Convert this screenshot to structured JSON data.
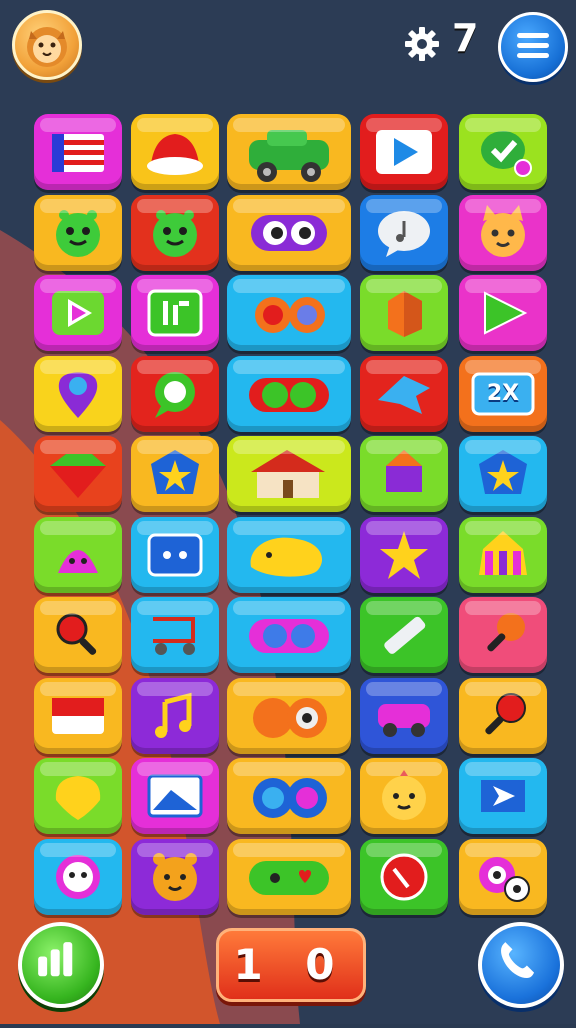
{
  "header": {
    "avatar_icon": "lion-avatar-icon",
    "settings_icon": "gear-icon",
    "level_value": "7",
    "menu_icon": "hamburger-menu-icon"
  },
  "board": {
    "rows": 10,
    "columns": 5,
    "tiles": [
      {
        "row": 1,
        "col": 1,
        "color": "#e52fd8",
        "icon": "flag-stripes-icon"
      },
      {
        "row": 1,
        "col": 2,
        "color": "#f9c41a",
        "icon": "cap-hat-icon"
      },
      {
        "row": 1,
        "col": 3,
        "color": "#f9b820",
        "icon": "green-car-icon"
      },
      {
        "row": 1,
        "col": 4,
        "color": "#e21d1d",
        "icon": "play-arrow-icon"
      },
      {
        "row": 1,
        "col": 5,
        "color": "#9be21f",
        "icon": "check-badge-icon"
      },
      {
        "row": 2,
        "col": 1,
        "color": "#f9b820",
        "icon": "green-monster-icon"
      },
      {
        "row": 2,
        "col": 2,
        "color": "#e3311d",
        "icon": "green-monster-icon"
      },
      {
        "row": 2,
        "col": 3,
        "color": "#f9b820",
        "icon": "purple-eyes-icon"
      },
      {
        "row": 2,
        "col": 4,
        "color": "#1d7de6",
        "icon": "music-bubble-icon"
      },
      {
        "row": 2,
        "col": 5,
        "color": "#ea33c9",
        "icon": "cat-face-icon"
      },
      {
        "row": 3,
        "col": 1,
        "color": "#e52fd8",
        "icon": "play-triangle-icon"
      },
      {
        "row": 3,
        "col": 2,
        "color": "#e52fd8",
        "icon": "green-sign-icon"
      },
      {
        "row": 3,
        "col": 3,
        "color": "#23b8ef",
        "icon": "binoculars-icon"
      },
      {
        "row": 3,
        "col": 4,
        "color": "#7adc2a",
        "icon": "orange-cube-icon"
      },
      {
        "row": 3,
        "col": 5,
        "color": "#ea33c9",
        "icon": "green-play-icon"
      },
      {
        "row": 4,
        "col": 1,
        "color": "#f9d31c",
        "icon": "location-pin-icon"
      },
      {
        "row": 4,
        "col": 2,
        "color": "#e3241d",
        "icon": "chat-bubble-icon"
      },
      {
        "row": 4,
        "col": 3,
        "color": "#23b8ef",
        "icon": "green-goggles-icon"
      },
      {
        "row": 4,
        "col": 4,
        "color": "#e3241d",
        "icon": "blue-bird-icon"
      },
      {
        "row": 4,
        "col": 5,
        "color": "#f3711c",
        "icon": "multiplier-badge-icon",
        "label": "2X"
      },
      {
        "row": 5,
        "col": 1,
        "color": "#e8421d",
        "icon": "red-gem-icon"
      },
      {
        "row": 5,
        "col": 2,
        "color": "#f9b820",
        "icon": "star-shield-icon"
      },
      {
        "row": 5,
        "col": 3,
        "color": "#cbe81c",
        "icon": "house-icon"
      },
      {
        "row": 5,
        "col": 4,
        "color": "#7adc2a",
        "icon": "purple-gem-icon"
      },
      {
        "row": 5,
        "col": 5,
        "color": "#23b8ef",
        "icon": "star-shield-icon"
      },
      {
        "row": 6,
        "col": 1,
        "color": "#7adc2a",
        "icon": "pink-blob-icon"
      },
      {
        "row": 6,
        "col": 2,
        "color": "#23b8ef",
        "icon": "robot-screen-icon"
      },
      {
        "row": 6,
        "col": 3,
        "color": "#23b8ef",
        "icon": "yellow-duck-icon"
      },
      {
        "row": 6,
        "col": 4,
        "color": "#8d2ad8",
        "icon": "yellow-star-icon"
      },
      {
        "row": 6,
        "col": 5,
        "color": "#7adc2a",
        "icon": "circus-tent-icon"
      },
      {
        "row": 7,
        "col": 1,
        "color": "#f9b820",
        "icon": "magnifier-icon"
      },
      {
        "row": 7,
        "col": 2,
        "color": "#23b8ef",
        "icon": "cart-icon"
      },
      {
        "row": 7,
        "col": 3,
        "color": "#23b8ef",
        "icon": "pink-goggles-icon"
      },
      {
        "row": 7,
        "col": 4,
        "color": "#3cc428",
        "icon": "pencil-icon"
      },
      {
        "row": 7,
        "col": 5,
        "color": "#f04d7a",
        "icon": "ice-cream-icon"
      },
      {
        "row": 8,
        "col": 1,
        "color": "#f9b820",
        "icon": "red-card-icon"
      },
      {
        "row": 8,
        "col": 2,
        "color": "#8d2ad8",
        "icon": "music-note-icon"
      },
      {
        "row": 8,
        "col": 3,
        "color": "#f9b820",
        "icon": "orange-binoculars-icon"
      },
      {
        "row": 8,
        "col": 4,
        "color": "#2f55d8",
        "icon": "pink-car-icon"
      },
      {
        "row": 8,
        "col": 5,
        "color": "#f9b820",
        "icon": "lollipop-icon"
      },
      {
        "row": 9,
        "col": 1,
        "color": "#7adc2a",
        "icon": "yellow-bell-icon"
      },
      {
        "row": 9,
        "col": 2,
        "color": "#e52fd8",
        "icon": "picture-frame-icon"
      },
      {
        "row": 9,
        "col": 3,
        "color": "#f9b820",
        "icon": "blue-binoculars-icon"
      },
      {
        "row": 9,
        "col": 4,
        "color": "#f9b820",
        "icon": "cookie-face-icon"
      },
      {
        "row": 9,
        "col": 5,
        "color": "#23b8ef",
        "icon": "blue-arrow-gem-icon"
      },
      {
        "row": 10,
        "col": 1,
        "color": "#23b8ef",
        "icon": "flower-face-icon"
      },
      {
        "row": 10,
        "col": 2,
        "color": "#8d2ad8",
        "icon": "bear-face-icon"
      },
      {
        "row": 10,
        "col": 3,
        "color": "#f9b820",
        "icon": "heart-goggles-icon"
      },
      {
        "row": 10,
        "col": 4,
        "color": "#3cc428",
        "icon": "red-phone-icon"
      },
      {
        "row": 10,
        "col": 5,
        "color": "#f9b820",
        "icon": "soccer-eye-icon"
      }
    ]
  },
  "footer": {
    "left_icon": "signal-bars-icon",
    "moves_value": "1 0",
    "right_icon": "phone-icon"
  }
}
